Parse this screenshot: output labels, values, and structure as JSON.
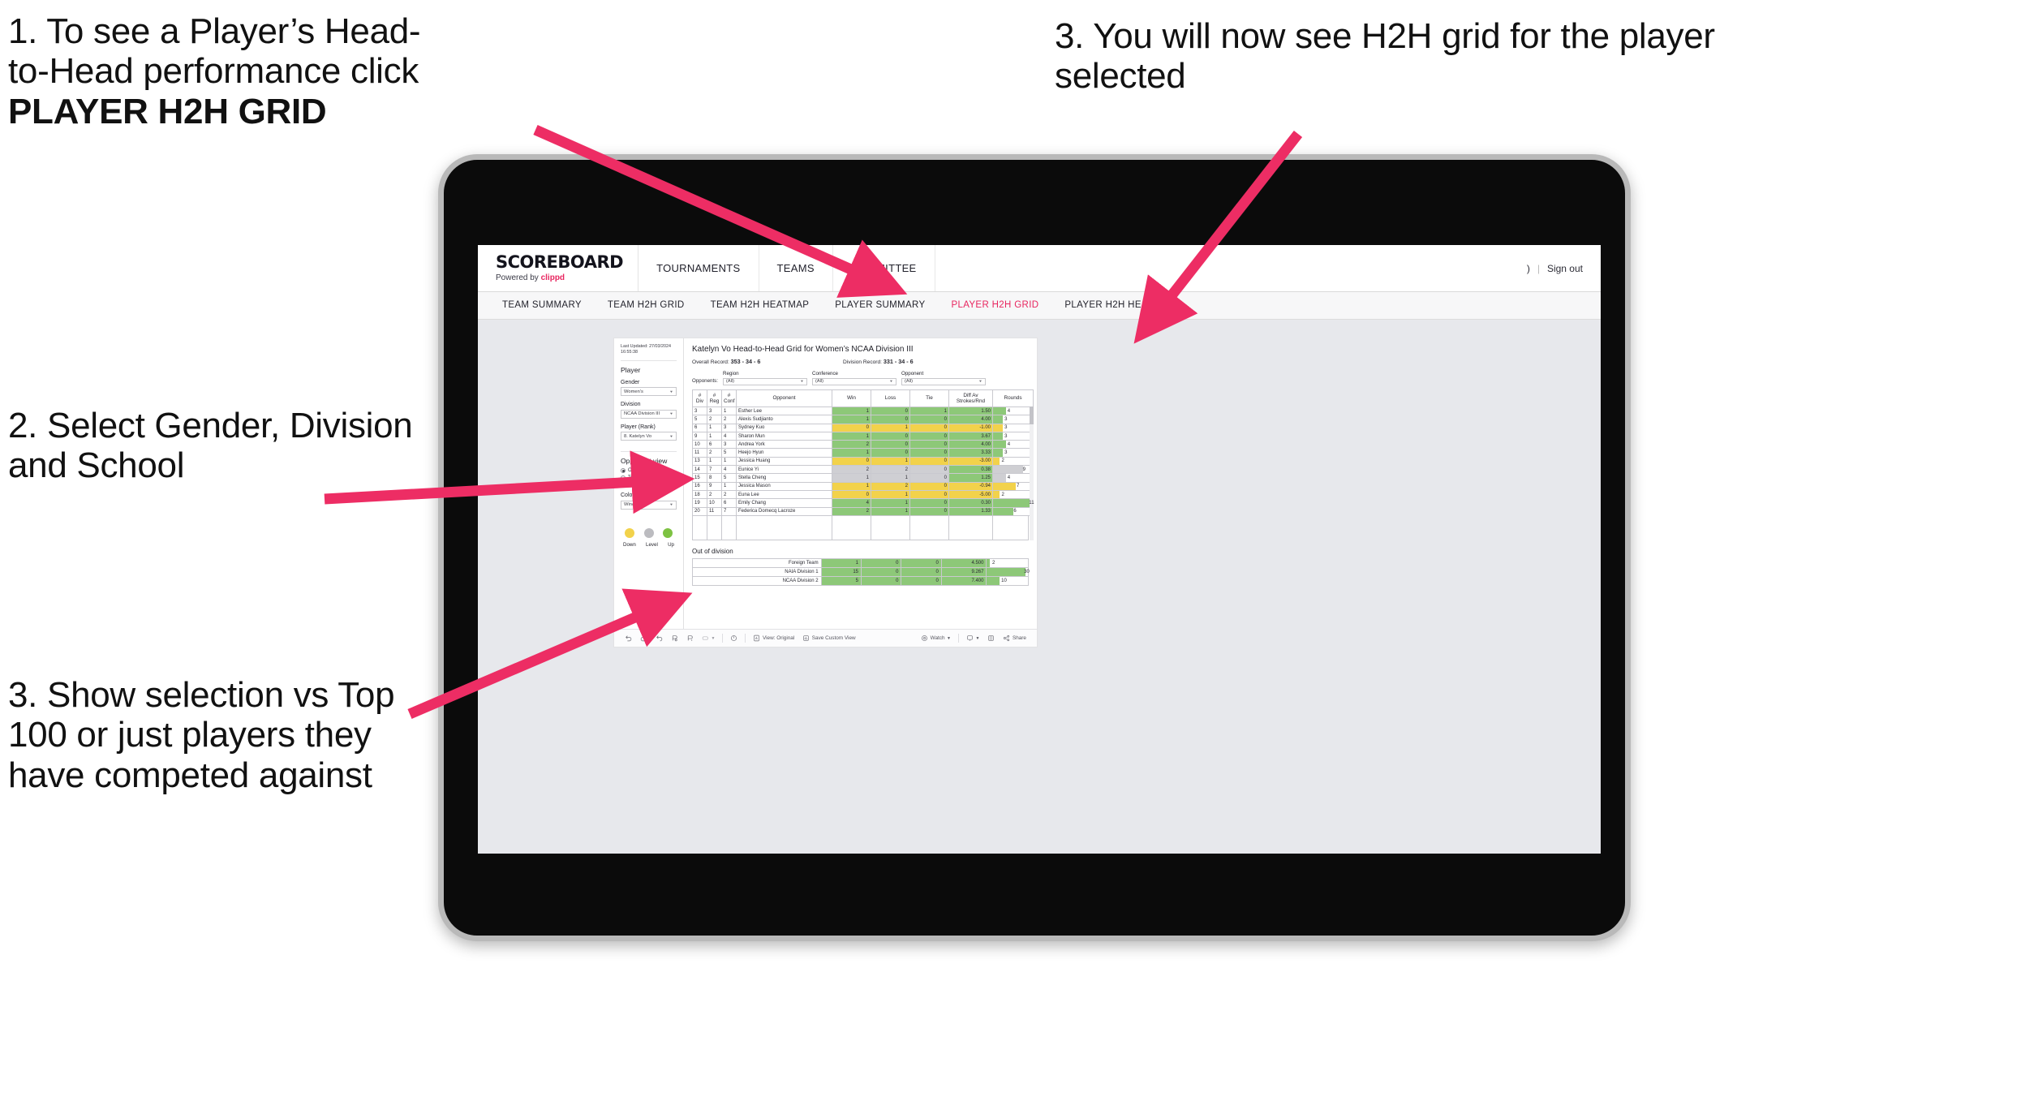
{
  "annotations": {
    "a1_line1": "1. To see a Player’s Head-",
    "a1_line2": "to-Head performance click",
    "a1_bold": "PLAYER H2H GRID",
    "a2": "2. Select Gender, Division and School",
    "a3": "3. Show selection vs Top 100 or just players they have competed against",
    "a4": "3. You will now see H2H grid for the player selected",
    "arrow_color": "#ED2D64"
  },
  "header": {
    "brand_name": "SCOREBOARD",
    "brand_sub_prefix": "Powered by ",
    "brand_sub_accent": "clippd",
    "nav": [
      "TOURNAMENTS",
      "TEAMS",
      "COMMITTEE"
    ],
    "user_glyph": ")",
    "separator": "|",
    "sign_out": "Sign out"
  },
  "subnav": {
    "items": [
      {
        "label": "TEAM SUMMARY",
        "active": false
      },
      {
        "label": "TEAM H2H GRID",
        "active": false
      },
      {
        "label": "TEAM H2H HEATMAP",
        "active": false
      },
      {
        "label": "PLAYER SUMMARY",
        "active": false
      },
      {
        "label": "PLAYER H2H GRID",
        "active": true
      },
      {
        "label": "PLAYER H2H HEATMAP",
        "active": false
      }
    ],
    "active_color": "#E8255F"
  },
  "sidebar": {
    "last_updated": "Last Updated: 27/03/2024 16:55:38",
    "player_title": "Player",
    "gender": {
      "label": "Gender",
      "value": "Women’s"
    },
    "division": {
      "label": "Division",
      "value": "NCAA Division III"
    },
    "player_rank": {
      "label": "Player (Rank)",
      "value": "8. Katelyn Vo"
    },
    "opponent_view": {
      "title": "Opponent view",
      "options": [
        {
          "label": "Opponents Played",
          "selected": true
        },
        {
          "label": "Top 100",
          "selected": false
        }
      ]
    },
    "colour_by": {
      "label": "Colour by",
      "value": "Win/loss"
    },
    "legend": [
      {
        "label": "Down",
        "color": "#F2D24B"
      },
      {
        "label": "Level",
        "color": "#BCBCC0"
      },
      {
        "label": "Up",
        "color": "#7DC242"
      }
    ]
  },
  "view": {
    "title": "Katelyn Vo Head-to-Head Grid for Women’s NCAA Division III",
    "overall_record_label": "Overall Record:",
    "overall_record_value": "353 - 34 - 6",
    "division_record_label": "Division Record:",
    "division_record_value": "331 -  34 - 6",
    "opponents_label": "Opponents:",
    "filters": [
      {
        "label": "Region",
        "value": "(All)"
      },
      {
        "label": "Conference",
        "value": "(All)"
      },
      {
        "label": "Opponent",
        "value": "(All)"
      }
    ]
  },
  "chart_data": {
    "type": "table",
    "title": "Katelyn Vo Head-to-Head Grid for Women’s NCAA Division III",
    "columns": [
      "# Div",
      "# Reg",
      "# Conf",
      "Opponent",
      "Win",
      "Loss",
      "Tie",
      "Diff Av Strokes/Rnd",
      "Rounds"
    ],
    "column_header_lines": [
      [
        "#",
        "Div"
      ],
      [
        "#",
        "Reg"
      ],
      [
        "#",
        "Conf"
      ],
      [
        "Opponent"
      ],
      [
        "Win"
      ],
      [
        "Loss"
      ],
      [
        "Tie"
      ],
      [
        "Diff Av",
        "Strokes/Rnd"
      ],
      [
        "Rounds"
      ]
    ],
    "rounds_max": 12,
    "colors": {
      "up": "#8DC878",
      "down": "#F2D24B",
      "level": "#CFCFD3"
    },
    "rows": [
      {
        "div": "3",
        "reg": "3",
        "conf": "1",
        "opponent": "Esther Lee",
        "win": 1,
        "loss": 0,
        "tie": 1,
        "diff": "1.50",
        "rounds": 4,
        "state": "up"
      },
      {
        "div": "5",
        "reg": "2",
        "conf": "2",
        "opponent": "Alexis Sudjianto",
        "win": 1,
        "loss": 0,
        "tie": 0,
        "diff": "4.00",
        "rounds": 3,
        "state": "up"
      },
      {
        "div": "6",
        "reg": "1",
        "conf": "3",
        "opponent": "Sydney Kuo",
        "win": 0,
        "loss": 1,
        "tie": 0,
        "diff": "-1.00",
        "rounds": 3,
        "state": "down"
      },
      {
        "div": "9",
        "reg": "1",
        "conf": "4",
        "opponent": "Sharon Mun",
        "win": 1,
        "loss": 0,
        "tie": 0,
        "diff": "3.67",
        "rounds": 3,
        "state": "up"
      },
      {
        "div": "10",
        "reg": "6",
        "conf": "3",
        "opponent": "Andrea York",
        "win": 2,
        "loss": 0,
        "tie": 0,
        "diff": "4.00",
        "rounds": 4,
        "state": "up"
      },
      {
        "div": "11",
        "reg": "2",
        "conf": "5",
        "opponent": "Heejo Hyun",
        "win": 1,
        "loss": 0,
        "tie": 0,
        "diff": "3.33",
        "rounds": 3,
        "state": "up"
      },
      {
        "div": "13",
        "reg": "1",
        "conf": "1",
        "opponent": "Jessica Huang",
        "win": 0,
        "loss": 1,
        "tie": 0,
        "diff": "-3.00",
        "rounds": 2,
        "state": "down"
      },
      {
        "div": "14",
        "reg": "7",
        "conf": "4",
        "opponent": "Eunice Yi",
        "win": 2,
        "loss": 2,
        "tie": 0,
        "diff": "0.38",
        "rounds": 9,
        "state": "level",
        "diff_state": "up"
      },
      {
        "div": "15",
        "reg": "8",
        "conf": "5",
        "opponent": "Stella Cheng",
        "win": 1,
        "loss": 1,
        "tie": 0,
        "diff": "1.25",
        "rounds": 4,
        "state": "level",
        "diff_state": "up"
      },
      {
        "div": "16",
        "reg": "9",
        "conf": "1",
        "opponent": "Jessica Mason",
        "win": 1,
        "loss": 2,
        "tie": 0,
        "diff": "-0.94",
        "rounds": 7,
        "state": "down"
      },
      {
        "div": "18",
        "reg": "2",
        "conf": "2",
        "opponent": "Euna Lee",
        "win": 0,
        "loss": 1,
        "tie": 0,
        "diff": "-5.00",
        "rounds": 2,
        "state": "down"
      },
      {
        "div": "19",
        "reg": "10",
        "conf": "6",
        "opponent": "Emily Chang",
        "win": 4,
        "loss": 1,
        "tie": 0,
        "diff": "0.30",
        "rounds": 11,
        "state": "up"
      },
      {
        "div": "20",
        "reg": "11",
        "conf": "7",
        "opponent": "Federica Domecq Lacroze",
        "win": 2,
        "loss": 1,
        "tie": 0,
        "diff": "1.33",
        "rounds": 6,
        "state": "up"
      }
    ],
    "out_of_division": {
      "title": "Out of division",
      "rounds_max": 32,
      "rows": [
        {
          "name": "Foreign Team",
          "win": 1,
          "loss": 0,
          "tie": 0,
          "diff": "4.500",
          "rounds": 2,
          "state": "up"
        },
        {
          "name": "NAIA Division 1",
          "win": 15,
          "loss": 0,
          "tie": 0,
          "diff": "9.267",
          "rounds": 30,
          "state": "up"
        },
        {
          "name": "NCAA Division 2",
          "win": 5,
          "loss": 0,
          "tie": 0,
          "diff": "7.400",
          "rounds": 10,
          "state": "up"
        }
      ]
    }
  },
  "toolbar": {
    "undo": "undo-icon",
    "redo": "redo-icon",
    "revert": "revert-icon",
    "refresh": "refresh-data-icon",
    "pause": "pause-updates-icon",
    "view_original_label": "View: Original",
    "save_custom_view_label": "Save Custom View",
    "watch_label": "Watch",
    "share_label": "Share"
  }
}
